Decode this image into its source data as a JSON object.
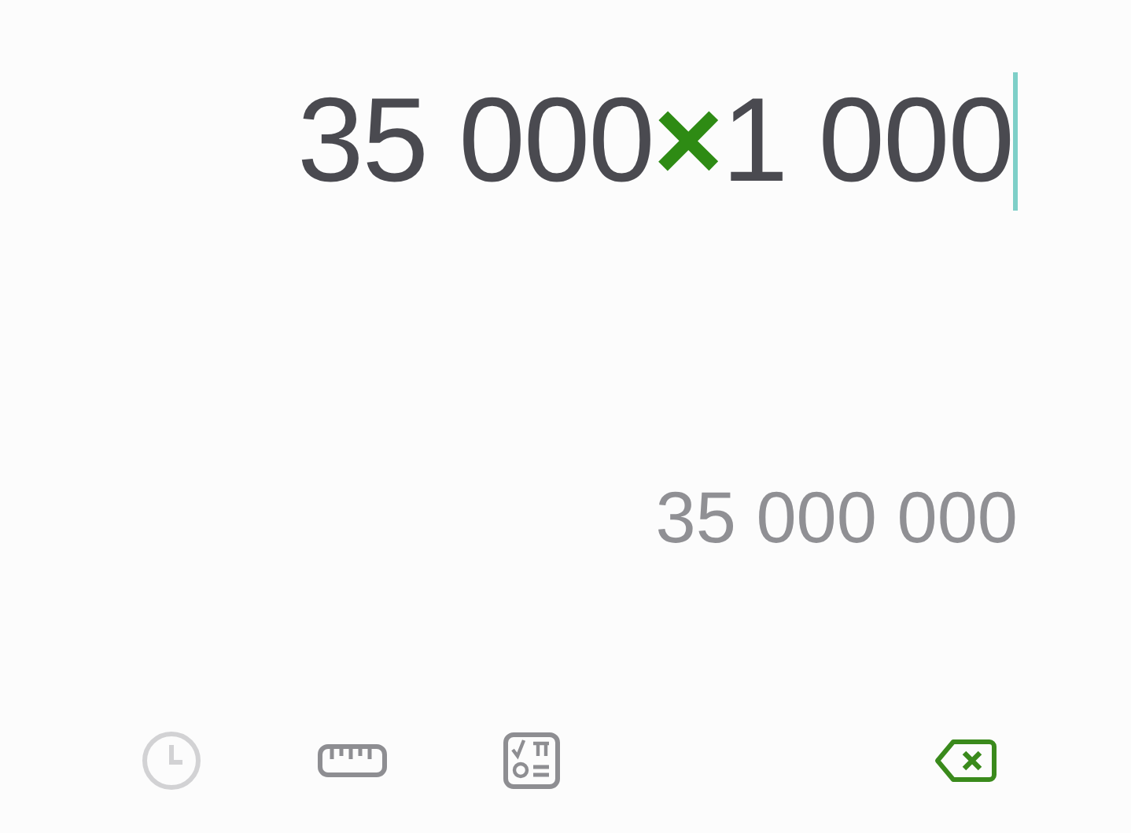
{
  "expression": [
    {
      "kind": "number",
      "text": "35 000"
    },
    {
      "kind": "operator",
      "text": "×"
    },
    {
      "kind": "number",
      "text": "1 000"
    }
  ],
  "result": "35 000 000",
  "toolbar": [
    {
      "kind": "history",
      "disabled": true
    },
    {
      "kind": "units",
      "disabled": false
    },
    {
      "kind": "scientific",
      "disabled": false
    },
    {
      "kind": "backspace",
      "disabled": false
    }
  ]
}
